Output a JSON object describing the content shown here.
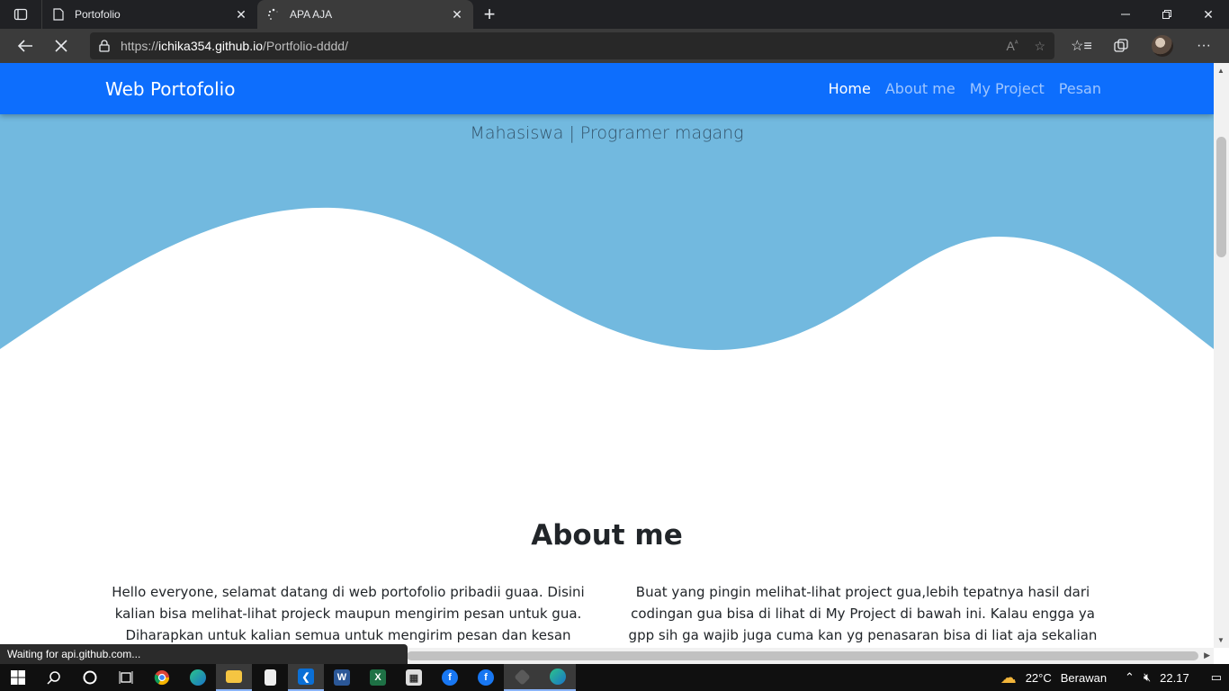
{
  "browser": {
    "tabs": [
      {
        "title": "Portofolio",
        "active": false
      },
      {
        "title": "APA AJA",
        "active": true
      }
    ],
    "url_prefix": "https://",
    "url_host": "ichika354.github.io",
    "url_path": "/Portfolio-dddd/",
    "status_text": "Waiting for api.github.com..."
  },
  "site": {
    "brand": "Web Portofolio",
    "nav": [
      "Home",
      "About me",
      "My Project",
      "Pesan"
    ],
    "hero_subtitle": "Mahasiswa | Programer magang",
    "about_title": "About me",
    "about_left": "Hello everyone, selamat datang di web portofolio pribadii guaa. Disini kalian bisa melihat-lihat projeck maupun mengirim pesan untuk gua. Diharapkan untuk kalian semua untuk mengirim pesan dan kesan mungkin lebih ke",
    "about_right": "Buat yang pingin melihat-lihat project gua,lebih tepatnya hasil dari codingan gua bisa di lihat di My Project di bawah ini. Kalau engga ya gpp sih ga wajib juga cuma kan yg penasaran bisa di liat aja sekalian mampir-mampir hheheh"
  },
  "taskbar": {
    "weather": "22°C",
    "weather_text": "Berawan",
    "time": "22.17"
  },
  "colors": {
    "navbar": "#0d6efd",
    "hero": "#72b9df"
  }
}
